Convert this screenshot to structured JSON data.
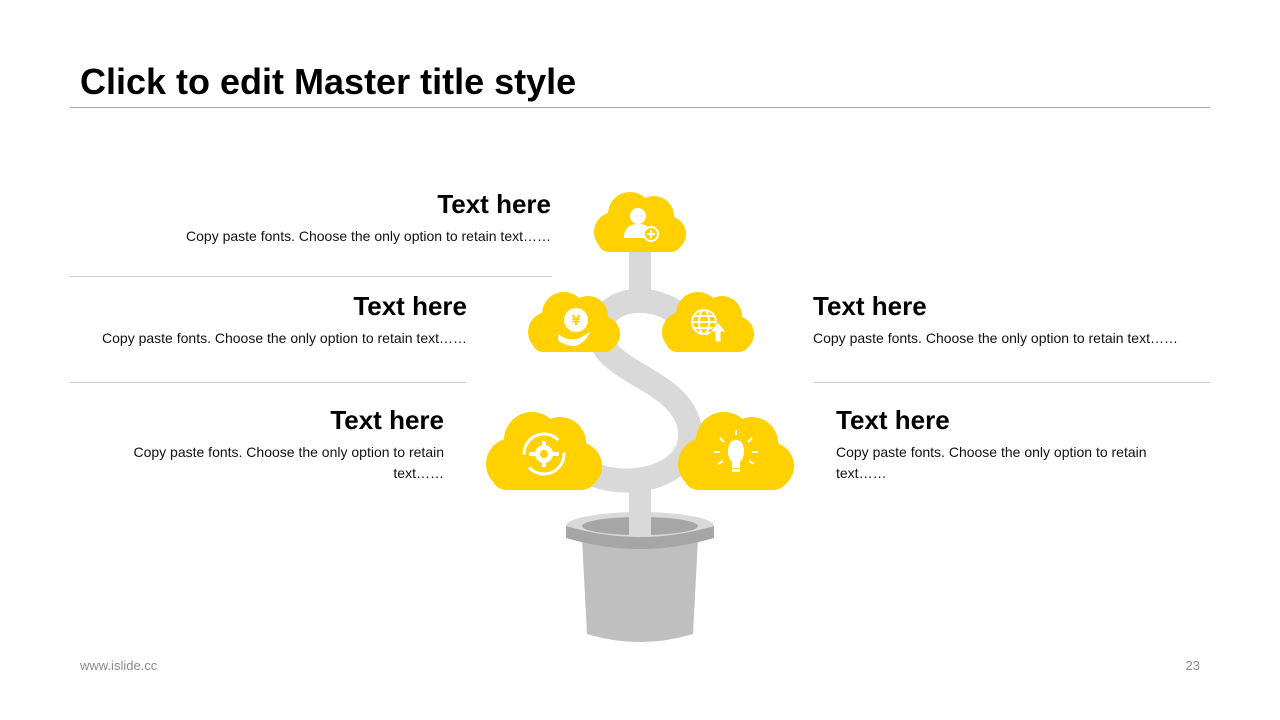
{
  "slide": {
    "title": "Click to edit Master title style",
    "footer_url": "www.islide.cc",
    "page_number": "23"
  },
  "blocks": [
    {
      "heading": "Text here",
      "body": "Copy paste fonts. Choose the only option to retain text……"
    },
    {
      "heading": "Text here",
      "body": "Copy paste fonts. Choose the only option to retain text……"
    },
    {
      "heading": "Text here",
      "body": "Copy paste fonts. Choose the only option to retain text……"
    },
    {
      "heading": "Text here",
      "body": "Copy paste fonts. Choose the only option to retain text……"
    },
    {
      "heading": "Text here",
      "body": "Copy paste fonts. Choose the only option to retain text……"
    }
  ],
  "colors": {
    "accent": "#FFD100",
    "stem": "#D9D9D9",
    "pot": "#BFBFBF"
  },
  "icons": [
    "user-add-icon",
    "yen-coin-icon",
    "globe-upload-icon",
    "gear-cycle-icon",
    "lightbulb-icon"
  ]
}
